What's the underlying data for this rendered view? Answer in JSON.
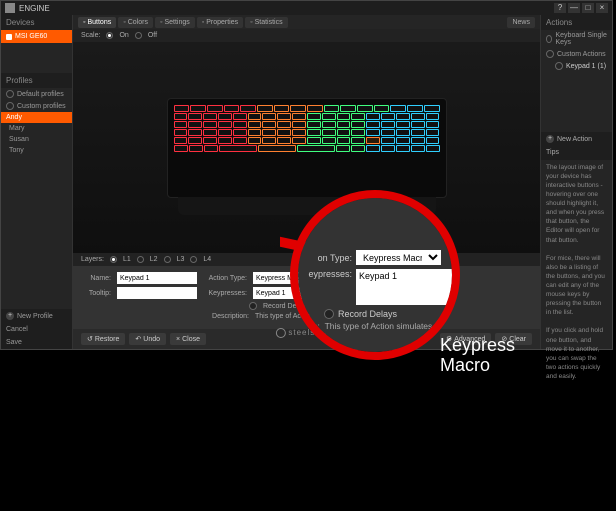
{
  "window": {
    "title": "ENGINE",
    "btn_min": "—",
    "btn_max": "□",
    "btn_help": "?",
    "btn_close": "×"
  },
  "left_panel": {
    "devices_label": "Devices",
    "device_name": "MSI GE60",
    "profiles_label": "Profiles",
    "default_profiles": "Default profiles",
    "custom_profiles": "Custom profiles",
    "profiles": [
      "Andy",
      "Mary",
      "Susan",
      "Tony"
    ],
    "active_profile_index": 0,
    "new_profile": "New Profile",
    "cancel": "Cancel",
    "save": "Save"
  },
  "tabs": {
    "buttons": "Buttons",
    "colors": "Colors",
    "settings": "Settings",
    "properties": "Properties",
    "statistics": "Statistics",
    "news": "News"
  },
  "scale": {
    "label": "Scale:",
    "on": "On",
    "off": "Off"
  },
  "layers": {
    "label": "Layers:",
    "l1": "L1",
    "l2": "L2",
    "l3": "L3",
    "l4": "L4"
  },
  "form": {
    "name_label": "Name:",
    "name_value": "Keypad 1",
    "tooltip_label": "Tooltip:",
    "tooltip_value": "",
    "action_type_label": "Action Type:",
    "action_type_value": "Keypress Macro",
    "keypresses_label": "Keypresses:",
    "keypresses_value": "Keypad 1",
    "record_delays": "Record Delays",
    "description_label": "Description:",
    "description_text": "This type of Action simulates keyboard..."
  },
  "buttons": {
    "restore": "Restore",
    "undo": "Undo",
    "close": "Close",
    "advanced": "Advanced",
    "clear": "Clear"
  },
  "footer_brand": "steelseries",
  "right_panel": {
    "actions_label": "Actions",
    "keyboard_single_keys": "Keyboard Single Keys",
    "custom_actions": "Custom Actions",
    "keypad1": "Keypad 1 (1)",
    "new_action": "New Action",
    "tips_label": "Tips",
    "tip1": "The layout image of your device has interactive buttons - hovering over one should highlight it, and when you press that button, the Editor will open for that button.",
    "tip2": "For mice, there will also be a listing of the buttons, and you can edit any of the mouse keys by pressing the button in the list.",
    "tip3": "If you click and hold one button, and move it to another, you can swap the two actions quickly and easily."
  },
  "magnifier": {
    "action_type_label": "on Type:",
    "action_type_value": "Keypress Macro",
    "keypresses_label": "eypresses:",
    "keypresses_value": "Keypad 1",
    "record_delays": "Record Delays",
    "desc_label": "on:",
    "desc_text": "This type of Action simulates keybo",
    "caption_line1": "Keypress",
    "caption_line2": "Macro"
  }
}
